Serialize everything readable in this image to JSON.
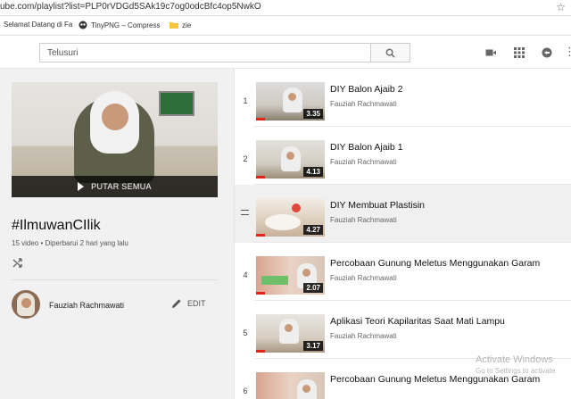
{
  "browser": {
    "url": "ube.com/playlist?list=PLP0rVDGd5SAk19c7og0odcBfc4op5NwkO",
    "bookmarks": [
      {
        "label": "Selamat Datang di Fa",
        "icon": "page-icon"
      },
      {
        "label": "TinyPNG – Compress",
        "icon": "panda-icon"
      },
      {
        "label": "zie",
        "icon": "folder-icon"
      }
    ]
  },
  "header": {
    "search_placeholder": "Telusuri",
    "icons": [
      "upload-icon",
      "apps-grid-icon",
      "chat-icon",
      "more-icon"
    ]
  },
  "playlist": {
    "play_all_label": "PUTAR SEMUA",
    "title": "#IlmuwanCIlik",
    "meta": "15 video • Diperbarui 2 hari yang lalu",
    "owner": "Fauziah Rachmawati",
    "edit_label": "EDIT"
  },
  "videos": [
    {
      "index": "1",
      "title": "DIY Balon Ajaib 2",
      "channel": "Fauziah Rachmawati",
      "duration": "3.35"
    },
    {
      "index": "2",
      "title": "DIY Balon Ajaib 1",
      "channel": "Fauziah Rachmawati",
      "duration": "4.13"
    },
    {
      "index": "",
      "title": "DIY Membuat Plastisin",
      "channel": "Fauziah Rachmawati",
      "duration": "4.27"
    },
    {
      "index": "4",
      "title": "Percobaan Gunung Meletus Menggunakan Garam",
      "channel": "Fauziah Rachmawati",
      "duration": "2.07"
    },
    {
      "index": "5",
      "title": "Aplikasi Teori Kapilaritas Saat Mati Lampu",
      "channel": "Fauziah Rachmawati",
      "duration": "3.17"
    },
    {
      "index": "6",
      "title": "Percobaan Gunung Meletus Menggunakan Garam",
      "channel": "",
      "duration": ""
    }
  ],
  "watermark": {
    "line1": "Activate Windows",
    "line2": "Go to Settings to activate"
  },
  "colors": {
    "accent_red": "#e62117",
    "page_bg": "#f1f1f1"
  }
}
